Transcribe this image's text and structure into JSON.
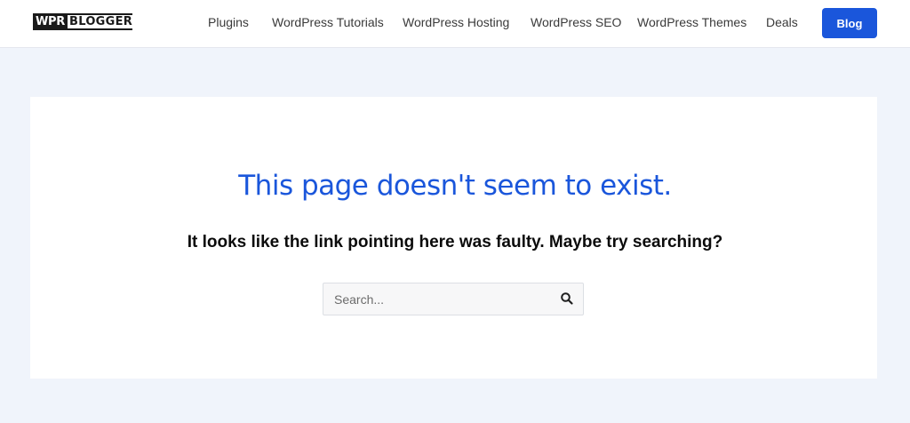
{
  "header": {
    "logo": {
      "part1": "WPR",
      "part2": "BLOGGER"
    },
    "nav": [
      {
        "label": "Plugins"
      },
      {
        "label": "WordPress Tutorials"
      },
      {
        "label": "WordPress Hosting"
      },
      {
        "label": "WordPress SEO"
      },
      {
        "label": "WordPress Themes"
      },
      {
        "label": "Deals"
      }
    ],
    "cta_label": "Blog"
  },
  "main": {
    "title": "This page doesn't seem to exist.",
    "subtitle": "It looks like the link pointing here was faulty. Maybe try searching?",
    "search": {
      "placeholder": "Search...",
      "value": "",
      "icon": "search-icon"
    }
  },
  "colors": {
    "accent": "#1a56db",
    "page_background": "#f0f4fb",
    "card_background": "#ffffff",
    "header_background": "#ffffff"
  }
}
